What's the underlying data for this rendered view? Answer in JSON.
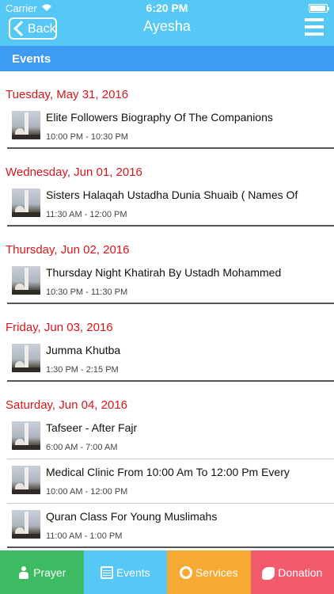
{
  "status_bar": {
    "carrier": "Carrier",
    "time": "6:20 PM",
    "battery_level": 0.95
  },
  "nav": {
    "back_label": "Back",
    "title": "Ayesha",
    "menu_icon": "hamburger-menu-icon"
  },
  "section": {
    "title": "Events"
  },
  "days": [
    {
      "date": "Tuesday, May 31, 2016",
      "events": [
        {
          "title": "Elite Followers Biography Of The Companions",
          "time": "10:00 PM - 10:30 PM"
        }
      ]
    },
    {
      "date": "Wednesday, Jun 01, 2016",
      "events": [
        {
          "title": " Sisters Halaqah  Ustadha Dunia Shuaib ( Names Of",
          "time": "11:30 AM - 12:00 PM"
        }
      ]
    },
    {
      "date": "Thursday, Jun 02, 2016",
      "events": [
        {
          "title": "Thursday Night Khatirah By Ustadh Mohammed",
          "time": "10:30 PM - 11:30 PM"
        }
      ]
    },
    {
      "date": "Friday, Jun 03, 2016",
      "events": [
        {
          "title": "Jumma Khutba",
          "time": "1:30 PM - 2:15 PM"
        }
      ]
    },
    {
      "date": "Saturday, Jun 04, 2016",
      "events": [
        {
          "title": "Tafseer - After Fajr",
          "time": "6:00 AM - 7:00 AM"
        },
        {
          "title": "Medical Clinic From 10:00 Am To 12:00 Pm Every",
          "time": "10:00 AM - 12:00 PM"
        },
        {
          "title": "Quran Class For Young Muslimahs",
          "time": "11:00 AM - 1:00 PM"
        }
      ]
    }
  ],
  "tabs": [
    {
      "label": "Prayer",
      "icon": "prayer-person-icon",
      "color": "#3dbb63"
    },
    {
      "label": "Events",
      "icon": "calendar-icon",
      "color": "#55c8f5"
    },
    {
      "label": "Services",
      "icon": "lifebuoy-icon",
      "color": "#f6aa34"
    },
    {
      "label": "Donation",
      "icon": "hand-donation-icon",
      "color": "#f25b6b"
    }
  ],
  "colors": {
    "header": "#55c8f5",
    "section_bar": "#3d9bf4",
    "date_text": "#d8161b"
  }
}
